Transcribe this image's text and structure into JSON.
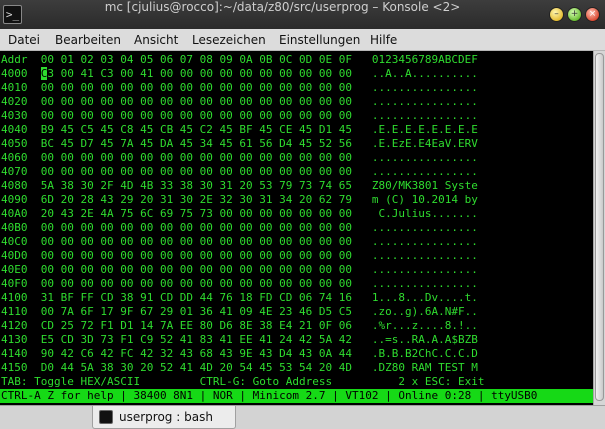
{
  "window": {
    "title": "mc [cjulius@rocco]:~/data/z80/src/userprog – Konsole <2>",
    "app_icon": ">_"
  },
  "menu": [
    "Datei",
    "Bearbeiten",
    "Ansicht",
    "Lesezeichen",
    "Einstellungen",
    "Hilfe"
  ],
  "hexview": {
    "header": "Addr  00 01 02 03 04 05 06 07 08 09 0A 0B 0C 0D 0E 0F   0123456789ABCDEF",
    "cursor_char": "C",
    "rows": [
      {
        "text": "4000  ",
        "after": "3 00 41 C3 00 41 00 00 00 00 00 00 00 00 00 00   ..A..A..........",
        "cursor": true
      },
      {
        "text": "4010  00 00 00 00 00 00 00 00 00 00 00 00 00 00 00 00   ................"
      },
      {
        "text": "4020  00 00 00 00 00 00 00 00 00 00 00 00 00 00 00 00   ................"
      },
      {
        "text": "4030  00 00 00 00 00 00 00 00 00 00 00 00 00 00 00 00   ................"
      },
      {
        "text": "4040  B9 45 C5 45 C8 45 CB 45 C2 45 BF 45 CE 45 D1 45   .E.E.E.E.E.E.E.E"
      },
      {
        "text": "4050  BC 45 D7 45 7A 45 DA 45 34 45 61 56 D4 45 52 56   .E.EzE.E4EaV.ERV"
      },
      {
        "text": "4060  00 00 00 00 00 00 00 00 00 00 00 00 00 00 00 00   ................"
      },
      {
        "text": "4070  00 00 00 00 00 00 00 00 00 00 00 00 00 00 00 00   ................"
      },
      {
        "text": "4080  5A 38 30 2F 4D 4B 33 38 30 31 20 53 79 73 74 65   Z80/MK3801 Syste"
      },
      {
        "text": "4090  6D 20 28 43 29 20 31 30 2E 32 30 31 34 20 62 79   m (C) 10.2014 by"
      },
      {
        "text": "40A0  20 43 2E 4A 75 6C 69 75 73 00 00 00 00 00 00 00    C.Julius......."
      },
      {
        "text": "40B0  00 00 00 00 00 00 00 00 00 00 00 00 00 00 00 00   ................"
      },
      {
        "text": "40C0  00 00 00 00 00 00 00 00 00 00 00 00 00 00 00 00   ................"
      },
      {
        "text": "40D0  00 00 00 00 00 00 00 00 00 00 00 00 00 00 00 00   ................"
      },
      {
        "text": "40E0  00 00 00 00 00 00 00 00 00 00 00 00 00 00 00 00   ................"
      },
      {
        "text": "40F0  00 00 00 00 00 00 00 00 00 00 00 00 00 00 00 00   ................"
      },
      {
        "text": "4100  31 BF FF CD 38 91 CD DD 44 76 18 FD CD 06 74 16   1...8...Dv....t."
      },
      {
        "text": "4110  00 7A 6F 17 9F 67 29 01 36 41 09 4E 23 46 D5 C5   .zo..g).6A.N#F.."
      },
      {
        "text": "4120  CD 25 72 F1 D1 14 7A EE 80 D6 8E 38 E4 21 0F 06   .%r...z....8.!.."
      },
      {
        "text": "4130  E5 CD 3D 73 F1 C9 52 41 83 41 EE 41 24 42 5A 42   ..=s..RA.A.A$BZB"
      },
      {
        "text": "4140  90 42 C6 42 FC 42 32 43 68 43 9E 43 D4 43 0A 44   .B.B.B2ChC.C.C.D"
      },
      {
        "text": "4150  D0 44 5A 38 30 20 52 41 4D 20 54 45 53 54 20 4D   .DZ80 RAM TEST M"
      }
    ],
    "help_line": "TAB: Toggle HEX/ASCII         CTRL-G: Goto Address          2 x ESC: Exit",
    "status_line": "CTRL-A Z for help | 38400 8N1 | NOR | Minicom 2.7 | VT102 | Online 0:28 | ttyUSB0"
  },
  "tabs": [
    {
      "label": "userprog : bash"
    }
  ]
}
